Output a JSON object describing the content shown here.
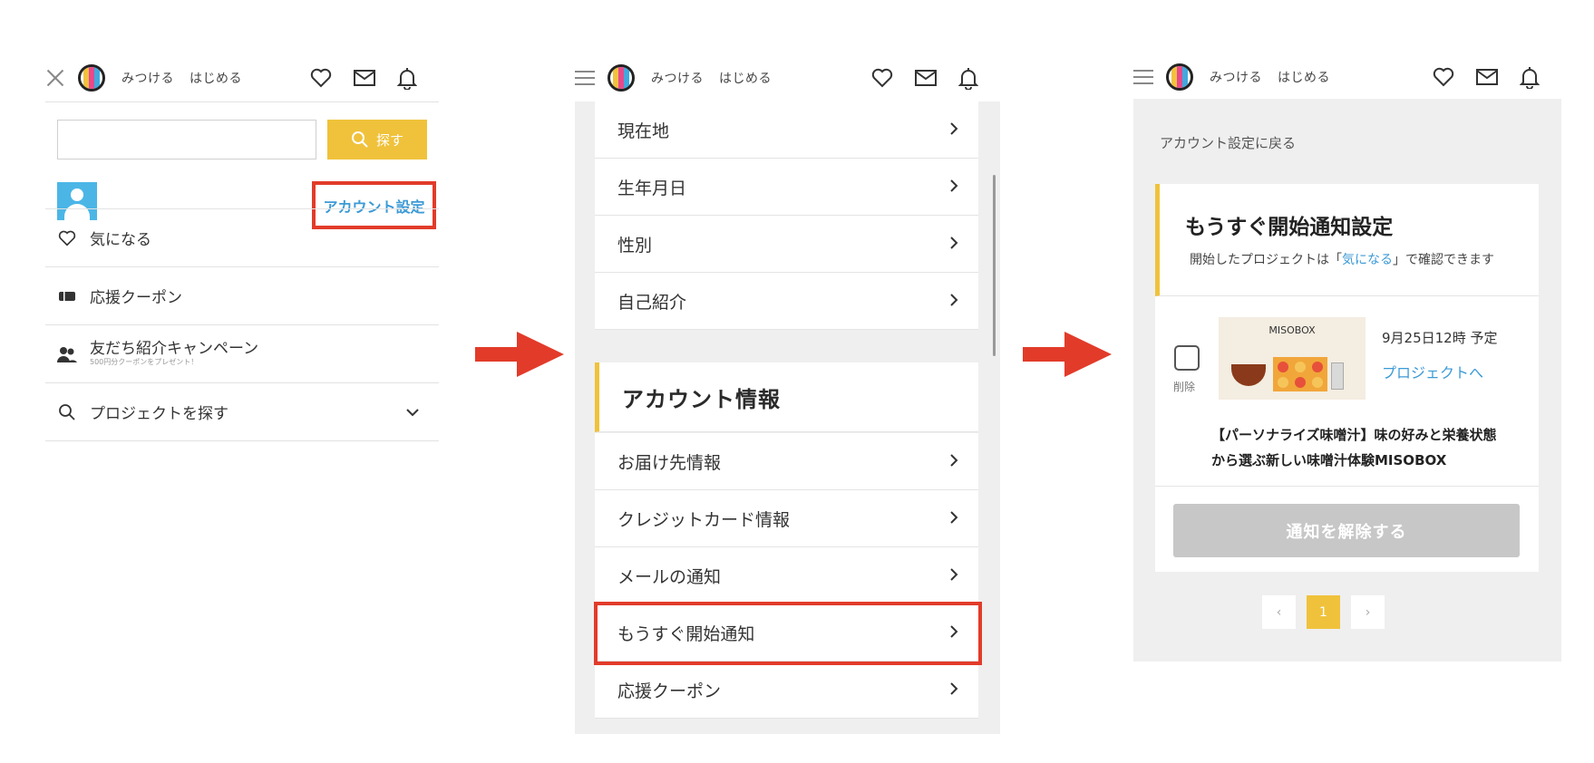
{
  "header": {
    "nav_find": "みつける",
    "nav_start": "はじめる"
  },
  "panel1": {
    "search_placeholder": "",
    "search_button": "探す",
    "account_settings": "アカウント設定",
    "menu": [
      {
        "label": "気になる",
        "icon": "heart-icon"
      },
      {
        "label": "応援クーポン",
        "icon": "ticket-icon"
      },
      {
        "label": "友だち紹介キャンペーン",
        "sub": "500円分クーポンをプレゼント！",
        "icon": "people-icon"
      },
      {
        "label": "プロジェクトを探す",
        "icon": "search-icon"
      }
    ]
  },
  "panel2": {
    "rows_top": [
      "現在地",
      "生年月日",
      "性別",
      "自己紹介"
    ],
    "section_title": "アカウント情報",
    "rows_bottom": [
      "お届け先情報",
      "クレジットカード情報",
      "メールの通知",
      "もうすぐ開始通知",
      "応援クーポン"
    ]
  },
  "panel3": {
    "back_link": "アカウント設定に戻る",
    "title": "もうすぐ開始通知設定",
    "subtitle_pre": "開始したプロジェクトは「",
    "subtitle_link": "気になる",
    "subtitle_post": "」で確認できます",
    "delete_label": "削除",
    "thumb_brand": "MISOBOX",
    "date": "9月25日12時 予定",
    "project_link": "プロジェクトへ",
    "project_title": "【パーソナライズ味噌汁】味の好みと栄養状態から選ぶ新しい味噌汁体験MISOBOX",
    "cancel_button": "通知を解除する",
    "pagination": {
      "prev": "‹",
      "current": "1",
      "next": "›"
    }
  },
  "colors": {
    "accent_yellow": "#f0c23b",
    "link_blue": "#3c9ad6",
    "highlight_red": "#e23b2a"
  }
}
